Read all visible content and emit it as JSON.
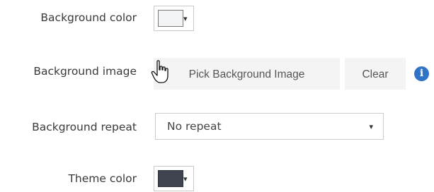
{
  "settings": {
    "background_color": {
      "label": "Background color",
      "swatch": "#f2f4f5",
      "caret": "▾"
    },
    "background_image": {
      "label": "Background image",
      "pick_label": "Pick Background Image",
      "clear_label": "Clear",
      "info_glyph": "i",
      "info_icon": "info-circle-icon"
    },
    "background_repeat": {
      "label": "Background repeat",
      "selected": "No repeat",
      "caret": "▾"
    },
    "theme_color": {
      "label": "Theme color",
      "swatch": "#3f4450",
      "caret": "▾"
    }
  },
  "cursor": {
    "icon": "hand-pointer-icon"
  }
}
